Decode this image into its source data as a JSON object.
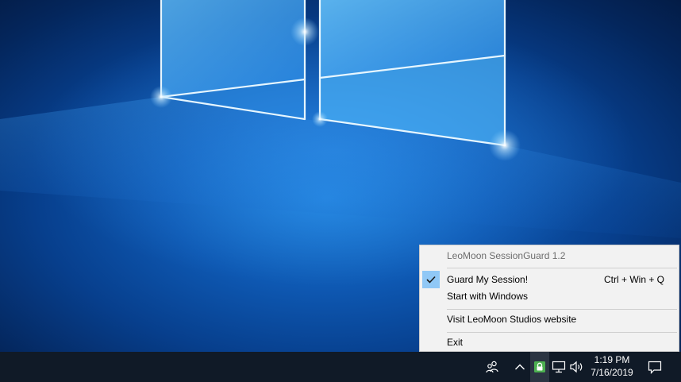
{
  "menu": {
    "title": "LeoMoon SessionGuard 1.2",
    "items": [
      {
        "label": "Guard My Session!",
        "shortcut": "Ctrl + Win + Q",
        "checked": true
      },
      {
        "label": "Start with Windows",
        "shortcut": "",
        "checked": false
      },
      {
        "label": "Visit LeoMoon Studios website",
        "shortcut": "",
        "checked": false
      },
      {
        "label": "Exit",
        "shortcut": "",
        "checked": false
      }
    ]
  },
  "taskbar": {
    "time": "1:19 PM",
    "date": "7/16/2019",
    "icons": [
      "people-icon",
      "chevron-up-icon",
      "sessionguard-lock-icon",
      "network-icon",
      "volume-icon",
      "action-center-icon"
    ]
  },
  "colors": {
    "taskbar": "#101a27",
    "menu_bg": "#f2f2f2",
    "check_highlight": "#90c8f6",
    "tray_app_icon": "#4caf50"
  }
}
